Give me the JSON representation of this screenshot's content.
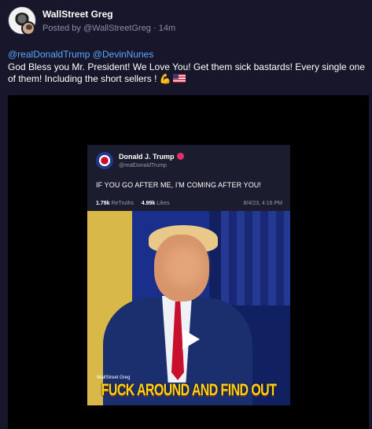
{
  "post": {
    "display_name": "WallStreet Greg",
    "posted_by": "Posted by @WallStreetGreg",
    "time_ago": "14m",
    "mentions": [
      "@realDonaldTrump",
      "@DevinNunes"
    ],
    "text": "God Bless you Mr. President! We Love You! Get them sick bastards! Every single one of them! Including the short sellers ! ",
    "emoji_icons": [
      "flexed-biceps-icon",
      "us-flag-icon"
    ]
  },
  "media": {
    "card": {
      "name": "Donald J. Trump",
      "handle": "@realDonaldTrump",
      "text": "IF YOU GO AFTER ME, I'M COMING AFTER YOU!",
      "retruths_count": "1.79k",
      "retruths_label": "ReTruths",
      "likes_count": "4.99k",
      "likes_label": "Likes",
      "datetime": "8/4/23, 4:16 PM"
    },
    "watermark": "WallStreet Greg",
    "caption": "FUCK AROUND AND FIND OUT",
    "play_icon": "play-icon"
  },
  "colors": {
    "background": "#18162a",
    "mention": "#5aa8ff",
    "caption": "#ffd21a",
    "verified": "#e0306a"
  }
}
